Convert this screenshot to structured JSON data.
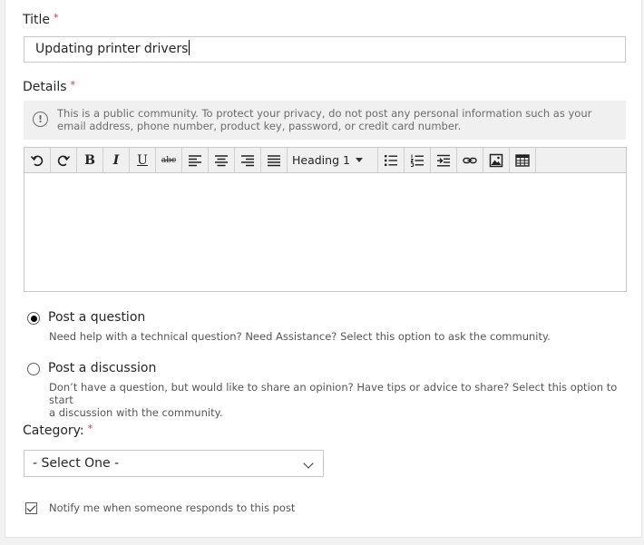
{
  "form": {
    "title_label": "Title",
    "required_mark": "*",
    "title_value": "Updating printer drivers",
    "details_label": "Details",
    "notice_text": "This is a public community. To protect your privacy, do not post any personal information such as your email address, phone number, product key, password, or credit card number.",
    "info_icon_glyph": "!"
  },
  "toolbar": {
    "buttons": [
      {
        "name": "undo-icon"
      },
      {
        "name": "redo-icon"
      },
      {
        "name": "bold-icon",
        "glyph": "B"
      },
      {
        "name": "italic-icon",
        "glyph": "I"
      },
      {
        "name": "underline-icon",
        "glyph": "U"
      },
      {
        "name": "strikethrough-icon",
        "glyph": "abc"
      },
      {
        "name": "align-left-icon"
      },
      {
        "name": "align-center-icon"
      },
      {
        "name": "align-right-icon"
      },
      {
        "name": "align-justify-icon"
      },
      {
        "name": "bulleted-list-icon"
      },
      {
        "name": "numbered-list-icon"
      },
      {
        "name": "indent-icon"
      },
      {
        "name": "link-icon"
      },
      {
        "name": "image-icon"
      },
      {
        "name": "table-icon"
      }
    ],
    "heading_value": "Heading 1"
  },
  "post_type": {
    "question_label": "Post a question",
    "question_desc": "Need help with a technical question? Need Assistance? Select this option to ask the community.",
    "question_selected": true,
    "discussion_label": "Post a discussion",
    "discussion_desc_line1": "Don’t have a question, but would like to share an opinion? Have tips or advice to share? Select this option to start",
    "discussion_desc_line2": "a discussion with the community.",
    "discussion_selected": false
  },
  "category": {
    "label": "Category:",
    "selected": "- Select One -"
  },
  "notify": {
    "label": "Notify me when someone responds to this post",
    "checked": true
  },
  "colors": {
    "required": "#d13438",
    "text": "#262626",
    "muted": "#6b6b6b",
    "border": "#c8c8c8"
  }
}
